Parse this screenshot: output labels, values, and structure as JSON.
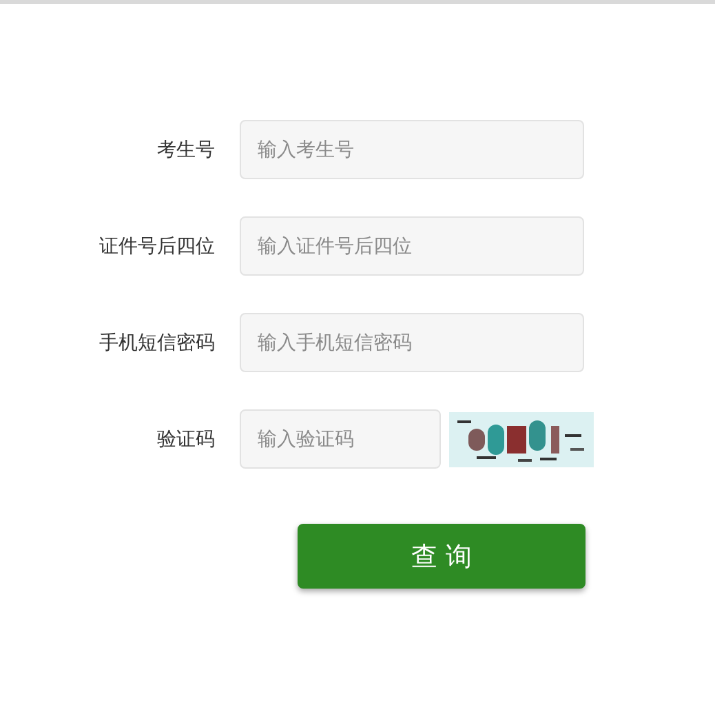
{
  "form": {
    "fields": [
      {
        "label": "考生号",
        "placeholder": "输入考生号",
        "kind": "text"
      },
      {
        "label": "证件号后四位",
        "placeholder": "输入证件号后四位",
        "kind": "text"
      },
      {
        "label": "手机短信密码",
        "placeholder": "输入手机短信密码",
        "kind": "text"
      },
      {
        "label": "验证码",
        "placeholder": "输入验证码",
        "kind": "captcha"
      }
    ],
    "submit": "查 询"
  }
}
